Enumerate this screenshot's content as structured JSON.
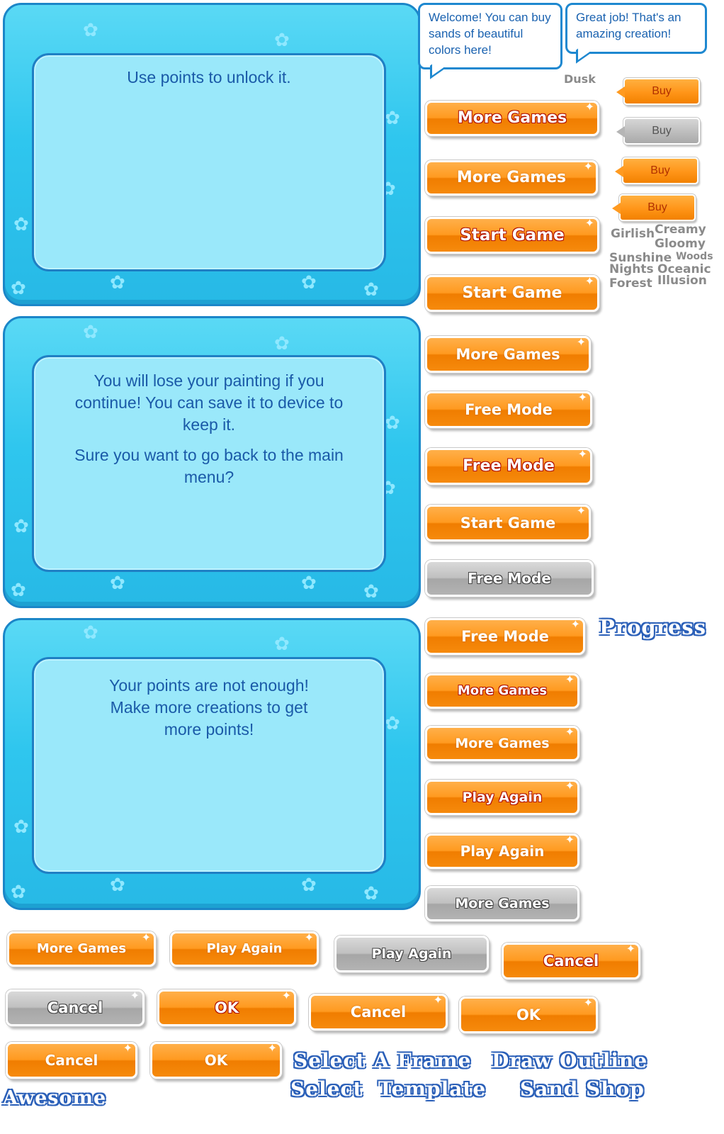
{
  "dialogs": [
    {
      "paragraphs": [
        "Use points to unlock it."
      ]
    },
    {
      "paragraphs": [
        "You will lose your painting if you continue! You can save it to device to keep it.",
        "Sure you want to go back to the main menu?"
      ]
    },
    {
      "paragraphs": [
        "Your points are not enough! Make more creations to get more points!"
      ]
    }
  ],
  "bubbles": {
    "welcome": "Welcome! You can buy sands of beautiful colors here!",
    "great_job": "Great job! That's an amazing creation!"
  },
  "buy_label": "Buy",
  "palettes": {
    "dusk": "Dusk",
    "girlish": "Girlish",
    "creamy": "Creamy",
    "gloomy": "Gloomy",
    "sunshine": "Sunshine",
    "woods": "Woods",
    "nights": "Nights",
    "oceanic": "Oceanic",
    "forest": "Forest",
    "illusion": "Illusion"
  },
  "buttons": {
    "more_games": "More Games",
    "start_game": "Start Game",
    "free_mode": "Free Mode",
    "play_again": "Play Again",
    "cancel": "Cancel",
    "ok": "OK"
  },
  "titles": {
    "progress": "Progress",
    "select_a_frame": "Select A Frame",
    "draw_outline": "Draw Outline",
    "select_template": "Select  Template",
    "sand_shop": "Sand Shop",
    "awesome": "Awesome"
  },
  "colors": {
    "panel_blue": "#2fc6ee",
    "inner_blue": "#9ae8fa",
    "button_orange": "#ff9a20",
    "button_grey": "#b3b3b3",
    "title_outline": "#2a5fb8"
  },
  "icons": {
    "flower": "flower-icon",
    "sparkle": "sparkle-icon"
  }
}
